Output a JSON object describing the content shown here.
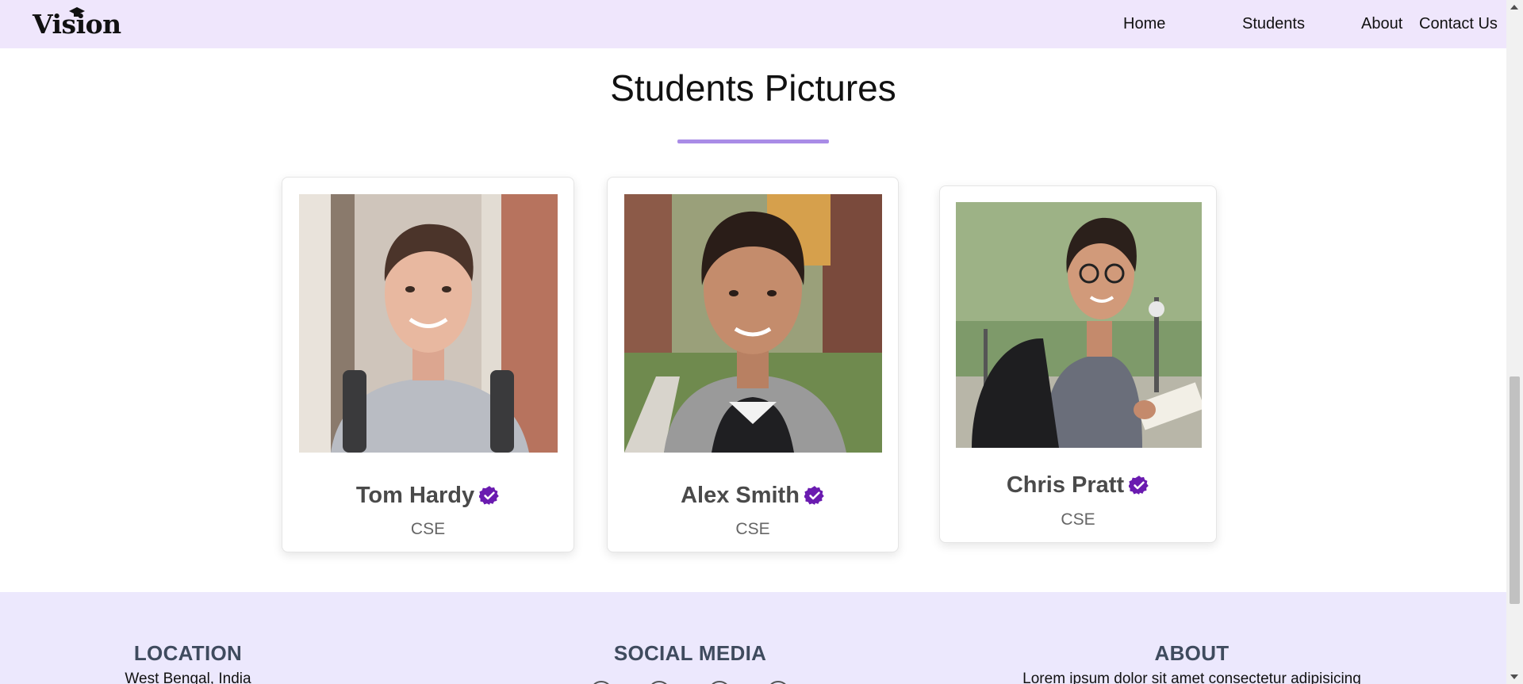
{
  "navbar": {
    "logo": "Vision",
    "links": [
      "Home",
      "Students",
      "About",
      "Contact Us"
    ]
  },
  "section": {
    "title": "Students Pictures"
  },
  "students": [
    {
      "name": "Tom Hardy",
      "dept": "CSE"
    },
    {
      "name": "Alex Smith",
      "dept": "CSE"
    },
    {
      "name": "Chris Pratt",
      "dept": "CSE"
    }
  ],
  "footer": {
    "location": {
      "heading": "LOCATION",
      "text": "West Bengal, India"
    },
    "social": {
      "heading": "SOCIAL MEDIA"
    },
    "about": {
      "heading": "ABOUT",
      "text": "Lorem ipsum dolor sit amet consectetur adipisicing"
    }
  },
  "colors": {
    "navbar_bg": "#efe6fc",
    "accent": "#a98ce6",
    "verified": "#6a1bb0",
    "footer_bg": "#ece8fd"
  },
  "icons": {
    "verified": "verified-badge-icon",
    "logo_hat": "graduation-cap-icon"
  }
}
